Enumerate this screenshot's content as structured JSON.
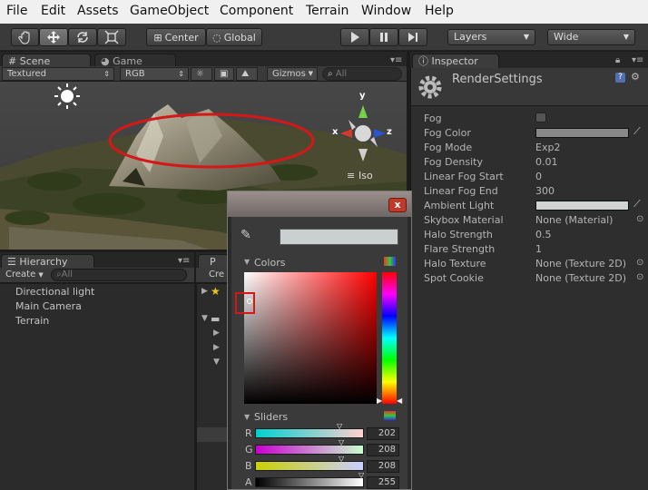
{
  "menu": [
    "File",
    "Edit",
    "Assets",
    "GameObject",
    "Component",
    "Terrain",
    "Window",
    "Help"
  ],
  "toolbar": {
    "pivot": "Center",
    "space": "Global",
    "layers": "Layers",
    "layout": "Wide"
  },
  "scene": {
    "tabs": [
      "Scene",
      "Game"
    ],
    "render_mode": "Textured",
    "color_mode": "RGB",
    "gizmos": "Gizmos",
    "search": "All",
    "projection": "Iso",
    "axis_x": "x",
    "axis_y": "y",
    "axis_z": "z"
  },
  "hierarchy": {
    "tab": "Hierarchy",
    "create": "Create",
    "search": "All",
    "items": [
      "Directional light",
      "Main Camera",
      "Terrain"
    ]
  },
  "project": {
    "tab": "P",
    "create": "Cre"
  },
  "inspector": {
    "tab": "Inspector",
    "title": "RenderSettings",
    "properties": [
      {
        "label": "Fog",
        "value": ""
      },
      {
        "label": "Fog Color",
        "value": ""
      },
      {
        "label": "Fog Mode",
        "value": "Exp2"
      },
      {
        "label": "Fog Density",
        "value": "0.01"
      },
      {
        "label": "Linear Fog Start",
        "value": "0"
      },
      {
        "label": "Linear Fog End",
        "value": "300"
      },
      {
        "label": "Ambient Light",
        "value": ""
      },
      {
        "label": "Skybox Material",
        "value": "None (Material)"
      },
      {
        "label": "Halo Strength",
        "value": "0.5"
      },
      {
        "label": "Flare Strength",
        "value": "1"
      },
      {
        "label": "Halo Texture",
        "value": "None (Texture 2D)"
      },
      {
        "label": "Spot Cookie",
        "value": "None (Texture 2D)"
      }
    ],
    "fog_color": "#888888",
    "ambient_color": "#cfd3d1"
  },
  "picker": {
    "close": "x",
    "colors_label": "Colors",
    "sliders_label": "Sliders",
    "swatch": "#cad0d0",
    "sliders": [
      {
        "label": "R",
        "value": "202"
      },
      {
        "label": "G",
        "value": "208"
      },
      {
        "label": "B",
        "value": "208"
      },
      {
        "label": "A",
        "value": "255"
      }
    ]
  }
}
